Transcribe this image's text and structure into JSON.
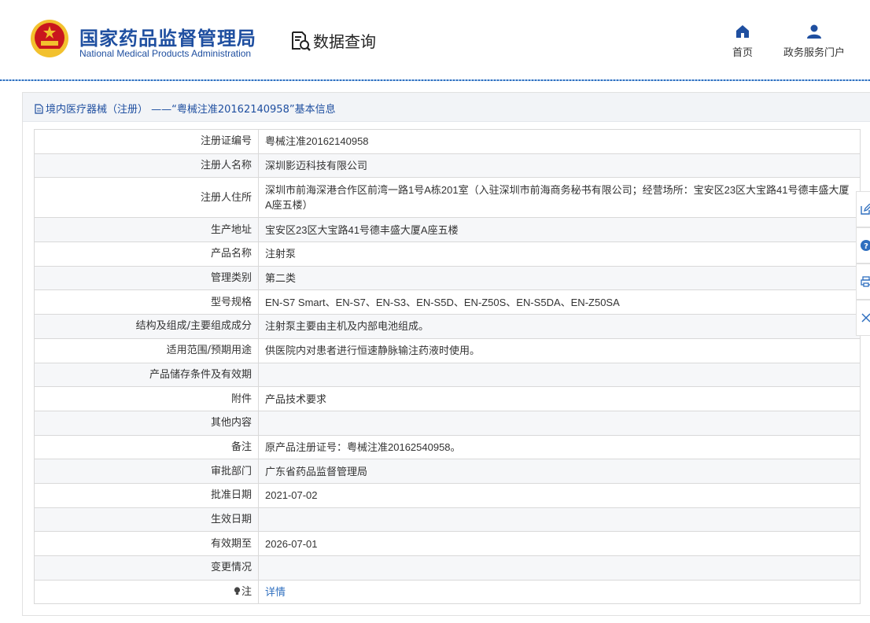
{
  "header": {
    "brand_cn": "国家药品监督管理局",
    "brand_en": "National Medical Products Administration",
    "query_title": "数据查询",
    "nav": [
      {
        "label": "首页",
        "icon": "home-icon"
      },
      {
        "label": "政务服务门户",
        "icon": "user-icon"
      }
    ]
  },
  "breadcrumb": {
    "text": "境内医疗器械（注册） ——“粤械注准20162140958”基本信息"
  },
  "details": [
    {
      "key": "注册证编号",
      "value": "粤械注准20162140958"
    },
    {
      "key": "注册人名称",
      "value": "深圳影迈科技有限公司"
    },
    {
      "key": "注册人住所",
      "value": "深圳市前海深港合作区前湾一路1号A栋201室（入驻深圳市前海商务秘书有限公司；经营场所：宝安区23区大宝路41号德丰盛大厦A座五楼）"
    },
    {
      "key": "生产地址",
      "value": "宝安区23区大宝路41号德丰盛大厦A座五楼"
    },
    {
      "key": "产品名称",
      "value": "注射泵"
    },
    {
      "key": "管理类别",
      "value": "第二类"
    },
    {
      "key": "型号规格",
      "value": "EN-S7 Smart、EN-S7、EN-S3、EN-S5D、EN-Z50S、EN-S5DA、EN-Z50SA"
    },
    {
      "key": "结构及组成/主要组成成分",
      "value": "注射泵主要由主机及内部电池组成。"
    },
    {
      "key": "适用范围/预期用途",
      "value": "供医院内对患者进行恒速静脉输注药液时使用。"
    },
    {
      "key": "产品储存条件及有效期",
      "value": ""
    },
    {
      "key": "附件",
      "value": "产品技术要求"
    },
    {
      "key": "其他内容",
      "value": ""
    },
    {
      "key": "备注",
      "value": "原产品注册证号：粤械注准20162540958。"
    },
    {
      "key": "审批部门",
      "value": "广东省药品监督管理局"
    },
    {
      "key": "批准日期",
      "value": "2021-07-02"
    },
    {
      "key": "生效日期",
      "value": ""
    },
    {
      "key": "有效期至",
      "value": "2026-07-01"
    },
    {
      "key": "变更情况",
      "value": ""
    },
    {
      "key": "注",
      "value": "详情"
    }
  ],
  "side_tools": [
    "edit-icon",
    "help-icon",
    "print-icon",
    "close-icon"
  ],
  "colors": {
    "brand": "#1f4fa0",
    "link": "#2f6fbf",
    "row_alt": "#f6f7f9",
    "emblem_red": "#c9161d",
    "emblem_gold": "#f2c12e"
  }
}
